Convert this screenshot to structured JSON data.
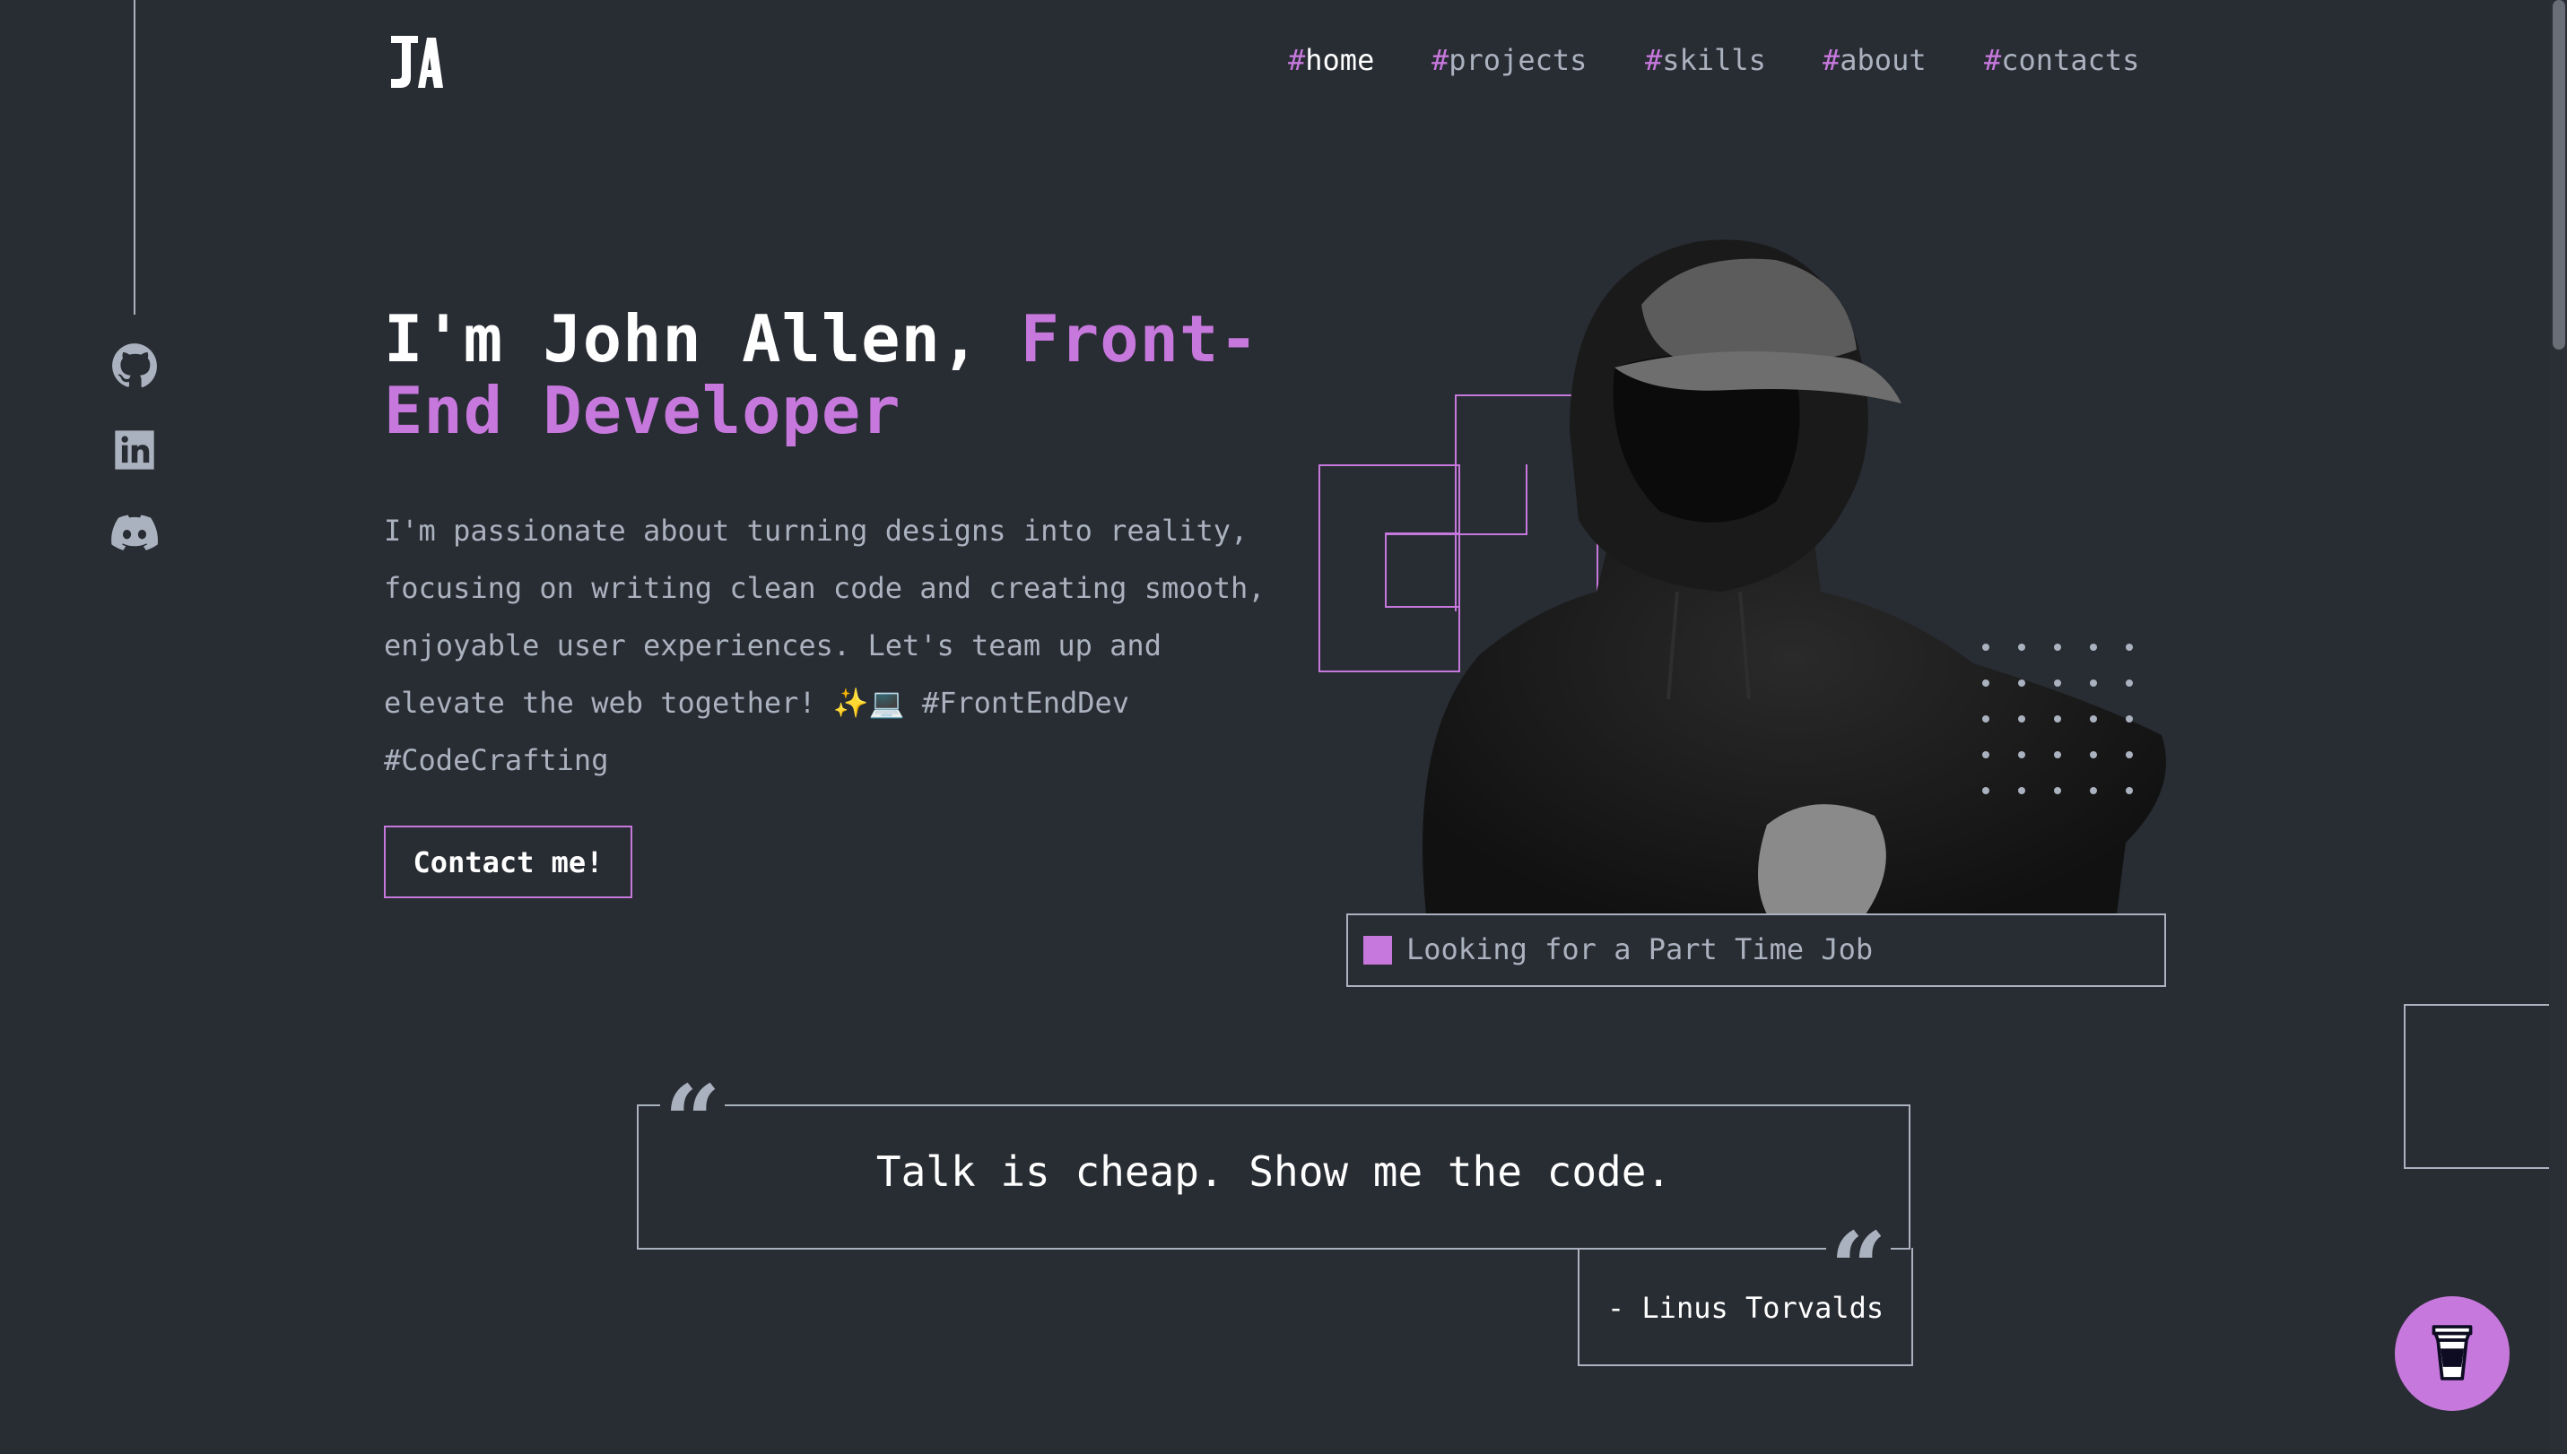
{
  "header": {
    "logo_text": "JA",
    "nav": [
      {
        "hash": "#",
        "label": "home",
        "active": true
      },
      {
        "hash": "#",
        "label": "projects",
        "active": false
      },
      {
        "hash": "#",
        "label": "skills",
        "active": false
      },
      {
        "hash": "#",
        "label": "about",
        "active": false
      },
      {
        "hash": "#",
        "label": "contacts",
        "active": false
      }
    ]
  },
  "social": {
    "icons": [
      "github-icon",
      "linkedin-icon",
      "discord-icon"
    ]
  },
  "hero": {
    "title_prefix": "I'm John Allen, ",
    "title_accent_line1": "Front-",
    "title_accent_line2": "End Developer",
    "description": "I'm passionate about turning designs into reality, focusing on writing clean code and creating smooth, enjoyable user experiences. Let's team up and elevate the web together! ✨💻 #FrontEndDev #CodeCrafting",
    "contact_button": "Contact me!",
    "status": "Looking for a Part Time Job"
  },
  "quote": {
    "text": "Talk is cheap. Show me the code.",
    "author": "- Linus Torvalds",
    "mark": "“"
  },
  "floating": {
    "icon": "coffee-cup-icon"
  },
  "colors": {
    "background": "#282c33",
    "accent": "#c778dd",
    "text_gray": "#abb2bf",
    "text_white": "#ffffff"
  }
}
